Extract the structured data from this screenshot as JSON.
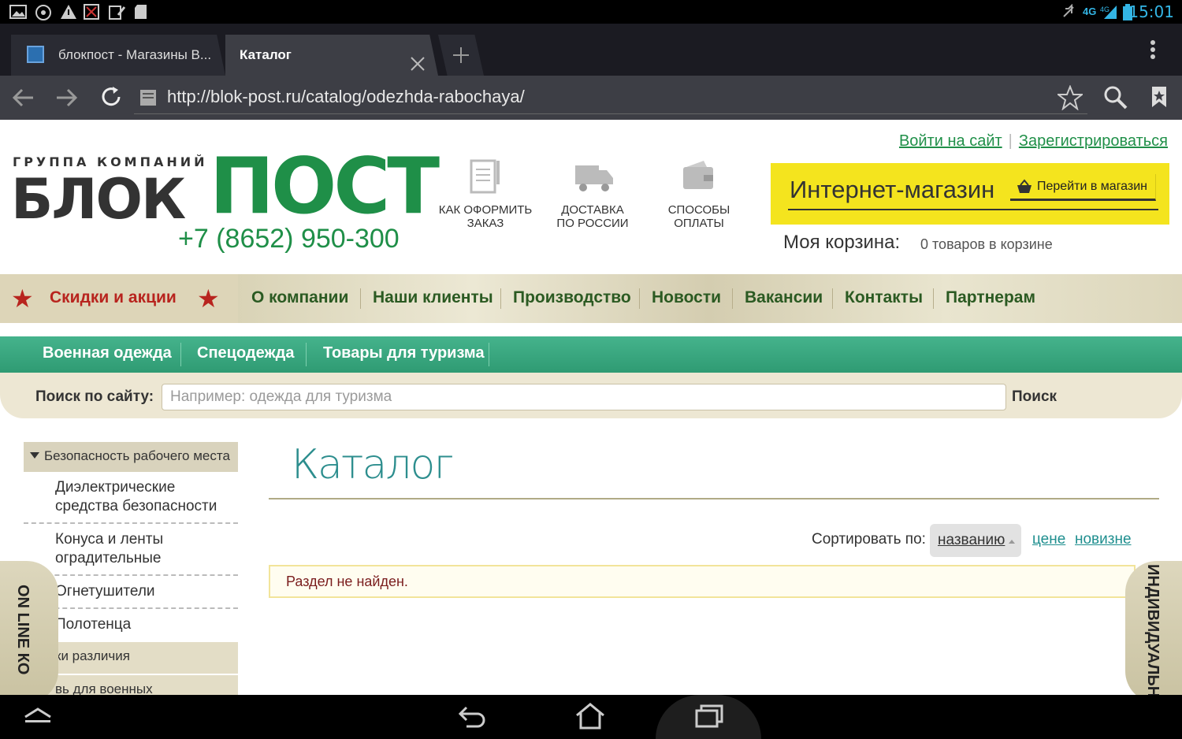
{
  "status_bar": {
    "time": "15:01",
    "network": "4G",
    "network_small": "4G"
  },
  "browser": {
    "tabs": [
      {
        "label": "блокпост - Магазины В..."
      },
      {
        "label": "Каталог"
      }
    ],
    "url": "http://blok-post.ru/catalog/odezhda-rabochaya/"
  },
  "header": {
    "logo_small": "ГРУППА КОМПАНИЙ",
    "logo_blok": "БЛОК",
    "logo_post": "ПОСТ",
    "phone": "+7 (8652) 950-300",
    "info": [
      {
        "line1": "КАК ОФОРМИТЬ",
        "line2": "ЗАКАЗ"
      },
      {
        "line1": "ДОСТАВКА",
        "line2": "ПО РОССИИ"
      },
      {
        "line1": "СПОСОБЫ",
        "line2": "ОПЛАТЫ"
      }
    ],
    "login": "Войти на сайт",
    "register": "Зарегистрироваться",
    "shop_title": "Интернет-магазин",
    "shop_button": "Перейти в магазин",
    "cart_label": "Моя корзина:",
    "cart_value": "0 товаров в корзине"
  },
  "main_menu": {
    "promo": "Скидки и акции",
    "items": [
      "О компании",
      "Наши клиенты",
      "Производство",
      "Новости",
      "Вакансии",
      "Контакты",
      "Партнерам"
    ]
  },
  "green_menu": {
    "items": [
      "Военная одежда",
      "Спецодежда",
      "Товары для туризма"
    ]
  },
  "search": {
    "label": "Поиск по сайту:",
    "placeholder": "Например: одежда для туризма",
    "button": "Поиск"
  },
  "sidebar": {
    "heading": "Безопасность рабочего места",
    "items": [
      {
        "line1": "Диэлектрические",
        "line2": "средства безопасности"
      },
      {
        "line1": "Конуса и ленты",
        "line2": "оградительные"
      },
      {
        "line1": "Огнетушители",
        "line2": ""
      },
      {
        "line1": "Полотенца",
        "line2": ""
      }
    ],
    "categories": [
      "ки различия",
      "вь для военных"
    ]
  },
  "content": {
    "title": "Каталог",
    "sort_label": "Сортировать по:",
    "sort_active": "названию",
    "sort_options": [
      "цене",
      "новизне"
    ],
    "message": "Раздел не найден."
  },
  "side_tabs": {
    "left": "ON LINE КО",
    "right": "ИНДИВИДУАЛЬН"
  },
  "colors": {
    "brand_green": "#1f8f48",
    "teal_bar": "#3aa97f",
    "shop_yellow": "#f4e41e",
    "promo_red": "#b8241e",
    "status_blue": "#33b5e5"
  }
}
